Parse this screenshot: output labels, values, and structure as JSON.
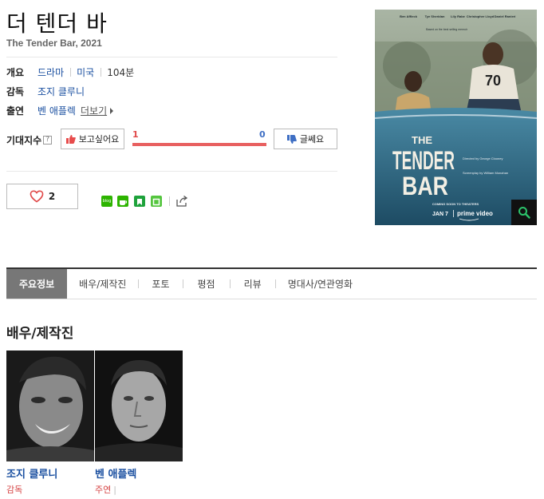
{
  "movie": {
    "title": "더 텐더 바",
    "original_title": "The Tender Bar, 2021"
  },
  "info": {
    "overview_label": "개요",
    "genre": "드라마",
    "country": "미국",
    "runtime": "104분",
    "director_label": "감독",
    "director": "조지 클루니",
    "cast_label": "출연",
    "cast": "벤 애플렉",
    "more_label": "더보기"
  },
  "expectation": {
    "label": "기대지수",
    "help": "?",
    "want_label": "보고싶어요",
    "no_label": "글쎄요",
    "want_count": "1",
    "no_count": "0",
    "want_ratio": 1.0
  },
  "like": {
    "count": "2"
  },
  "share": {
    "blog_label": "blog"
  },
  "poster": {
    "actors": [
      "Ben Affleck",
      "Tye Sheridan",
      "Lily Rabe",
      "Christopher Lloyd",
      "Daniel Ranieri"
    ],
    "tagline": "Based on the best selling memoir",
    "title_line1": "THE",
    "title_line2": "TENDER",
    "title_line3": "BAR",
    "director_credit": "Directed by George Clooney",
    "writer_credit": "Screenplay by William Monahan",
    "coming": "COMING SOON TO THEATERS",
    "date": "JAN 7",
    "service": "prime video",
    "jersey": "70"
  },
  "tabs": [
    "주요정보",
    "배우/제작진",
    "포토",
    "평점",
    "리뷰",
    "명대사/연관영화"
  ],
  "crew_section": {
    "title": "배우/제작진",
    "people": [
      {
        "name": "조지 클루니",
        "role": "감독"
      },
      {
        "name": "벤 애플렉",
        "role": "주연"
      }
    ]
  },
  "colors": {
    "link": "#1a4fa0",
    "want": "#e04848",
    "no": "#3f6fc4",
    "active_tab": "#777777"
  }
}
